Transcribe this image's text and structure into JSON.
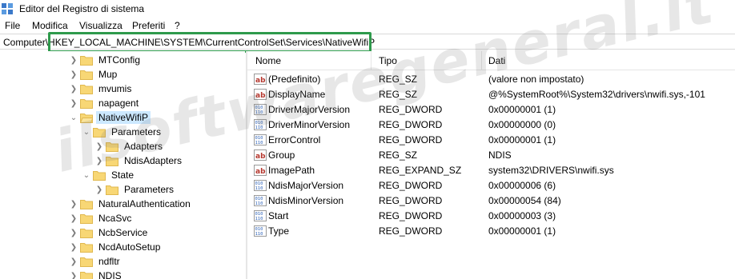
{
  "window": {
    "title": "Editor del Registro di sistema",
    "app_icon": "regedit-icon"
  },
  "menubar": {
    "items": [
      "File",
      "Modifica",
      "Visualizza",
      "Preferiti",
      "?"
    ]
  },
  "address": {
    "path": "Computer\\HKEY_LOCAL_MACHINE\\SYSTEM\\CurrentControlSet\\Services\\NativeWifiP"
  },
  "tree": {
    "items": [
      {
        "label": "MTConfig",
        "expander": "collapsed"
      },
      {
        "label": "Mup",
        "expander": "collapsed"
      },
      {
        "label": "mvumis",
        "expander": "collapsed"
      },
      {
        "label": "napagent",
        "expander": "collapsed"
      },
      {
        "label": "NativeWifiP",
        "expander": "expanded",
        "selected": true
      },
      {
        "label": "Parameters",
        "expander": "expanded"
      },
      {
        "label": "Adapters",
        "expander": "collapsed"
      },
      {
        "label": "NdisAdapters",
        "expander": "collapsed"
      },
      {
        "label": "State",
        "expander": "expanded"
      },
      {
        "label": "Parameters",
        "expander": "collapsed"
      },
      {
        "label": "NaturalAuthentication",
        "expander": "collapsed"
      },
      {
        "label": "NcaSvc",
        "expander": "collapsed"
      },
      {
        "label": "NcbService",
        "expander": "collapsed"
      },
      {
        "label": "NcdAutoSetup",
        "expander": "collapsed"
      },
      {
        "label": "ndfltr",
        "expander": "collapsed"
      },
      {
        "label": "NDIS",
        "expander": "collapsed"
      }
    ]
  },
  "list": {
    "columns": [
      "Nome",
      "Tipo",
      "Dati"
    ],
    "rows": [
      {
        "name": "(Predefinito)",
        "type": "REG_SZ",
        "data": "(valore non impostato)",
        "icon": "string"
      },
      {
        "name": "DisplayName",
        "type": "REG_SZ",
        "data": "@%SystemRoot%\\System32\\drivers\\nwifi.sys,-101",
        "icon": "string"
      },
      {
        "name": "DriverMajorVersion",
        "type": "REG_DWORD",
        "data": "0x00000001 (1)",
        "icon": "binary"
      },
      {
        "name": "DriverMinorVersion",
        "type": "REG_DWORD",
        "data": "0x00000000 (0)",
        "icon": "binary"
      },
      {
        "name": "ErrorControl",
        "type": "REG_DWORD",
        "data": "0x00000001 (1)",
        "icon": "binary"
      },
      {
        "name": "Group",
        "type": "REG_SZ",
        "data": "NDIS",
        "icon": "string"
      },
      {
        "name": "ImagePath",
        "type": "REG_EXPAND_SZ",
        "data": "system32\\DRIVERS\\nwifi.sys",
        "icon": "string"
      },
      {
        "name": "NdisMajorVersion",
        "type": "REG_DWORD",
        "data": "0x00000006 (6)",
        "icon": "binary"
      },
      {
        "name": "NdisMinorVersion",
        "type": "REG_DWORD",
        "data": "0x00000054 (84)",
        "icon": "binary"
      },
      {
        "name": "Start",
        "type": "REG_DWORD",
        "data": "0x00000003 (3)",
        "icon": "binary"
      },
      {
        "name": "Type",
        "type": "REG_DWORD",
        "data": "0x00000001 (1)",
        "icon": "binary"
      }
    ]
  },
  "watermark": {
    "text": "ilsoftwaregeneral.it"
  },
  "colors": {
    "selection": "#cce8ff",
    "highlight_box": "#2e9a4c",
    "folder": "#f8d775",
    "folder_dark": "#e0b84f",
    "string_icon": "#b5372e",
    "binary_icon": "#2f63b8"
  }
}
